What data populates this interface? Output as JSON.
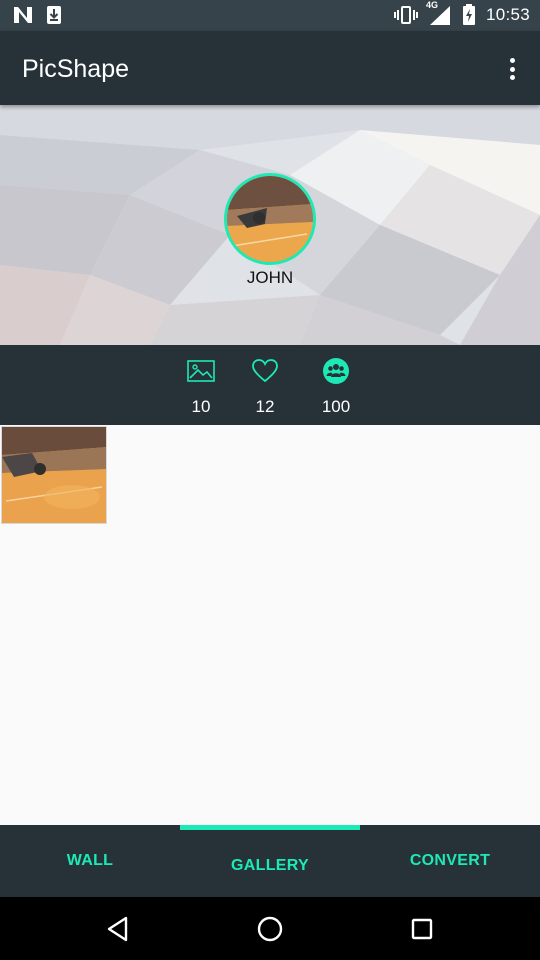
{
  "status_bar": {
    "time": "10:53",
    "network_label": "4G",
    "icons": [
      "n-notification-icon",
      "download-icon",
      "vibrate-icon",
      "signal-icon",
      "battery-charging-icon"
    ]
  },
  "app_bar": {
    "title": "PicShape",
    "menu_icon": "more-vert-icon"
  },
  "profile": {
    "name": "JOHN"
  },
  "stats": [
    {
      "icon": "image-icon",
      "value": "10"
    },
    {
      "icon": "heart-icon",
      "value": "12"
    },
    {
      "icon": "group-icon",
      "value": "100"
    }
  ],
  "gallery": {
    "items": [
      {
        "name": "gallery-thumbnail"
      }
    ]
  },
  "tabs": [
    {
      "label": "WALL",
      "active": false
    },
    {
      "label": "GALLERY",
      "active": true
    },
    {
      "label": "CONVERT",
      "active": false
    }
  ],
  "nav": {
    "icons": [
      "back-icon",
      "home-icon",
      "recents-icon"
    ]
  },
  "colors": {
    "accent": "#1de9b6",
    "primary_dark": "#263238",
    "status_bar": "#37434a",
    "background": "#fafafa"
  }
}
